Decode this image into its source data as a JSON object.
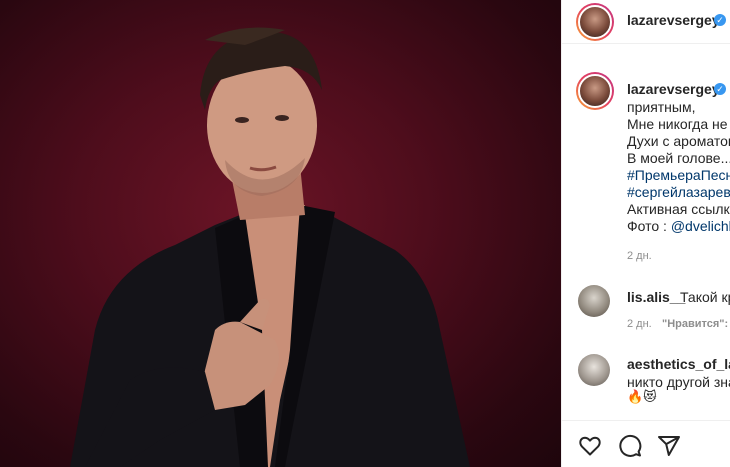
{
  "post": {
    "author": "lazarevsergey",
    "caption_lines": [
      "приятным,",
      "Мне никогда не",
      "Духи с ароматом",
      "В моей голове..."
    ],
    "hashtags": [
      "#ПремьераПесн",
      "#сергейлазарев"
    ],
    "link_line": "Активная ссылка",
    "photo_credit_prefix": "Фото : ",
    "photo_credit_handle": "@dvelichk",
    "time": "2 дн."
  },
  "comments": [
    {
      "user": "lis.alis__",
      "text": "Такой кр",
      "time": "2 дн.",
      "like_label": "\"Нравится\": "
    },
    {
      "user": "aesthetics_of_laz",
      "text": "никто другой зна",
      "emoji": "🔥😻"
    }
  ],
  "icons": {
    "like": "heart-icon",
    "comment": "comment-icon",
    "share": "share-icon",
    "verified": "verified-badge-icon"
  },
  "colors": {
    "link": "#00376b",
    "verified": "#3897f0",
    "photo_background": "#4e0d1c"
  }
}
